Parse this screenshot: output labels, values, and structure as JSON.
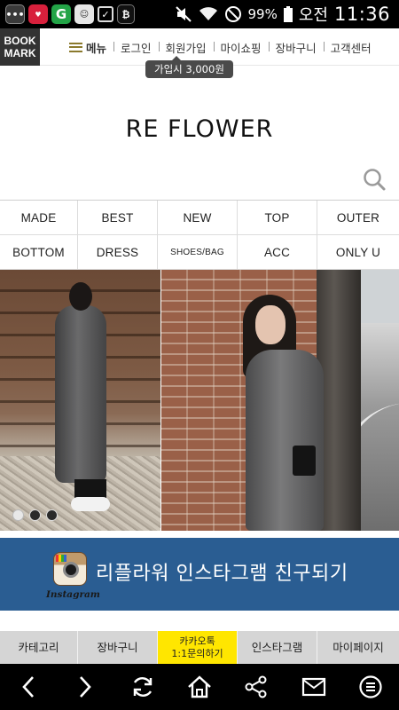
{
  "status_bar": {
    "apps": [
      "message-icon",
      "shopping-icon",
      "g-app-icon",
      "robot-icon",
      "check-icon",
      "bitcoin-icon"
    ],
    "g_app_label": "G",
    "battery": "99%",
    "ampm": "오전",
    "time": "11:36"
  },
  "nav": {
    "bookmark_line1": "BOOK",
    "bookmark_line2": "MARK",
    "menu_label": "메뉴",
    "links": [
      "로그인",
      "회원가입",
      "마이쇼핑",
      "장바구니",
      "고객센터"
    ],
    "tooltip": "가입시 3,000원"
  },
  "logo": "RE FLOWER",
  "categories": [
    "MADE",
    "BEST",
    "NEW",
    "TOP",
    "OUTER",
    "BOTTOM",
    "DRESS",
    "SHOES/BAG",
    "ACC",
    "ONLY U"
  ],
  "banner": {
    "slide_count": 3,
    "active_slide": 1
  },
  "instagram": {
    "wordmark": "Instagram",
    "text": "리플라워 인스타그램 친구되기"
  },
  "quick_bar": {
    "items": [
      "카테고리",
      "장바구니",
      "카카오톡",
      "인스타그램",
      "마이페이지"
    ],
    "kakao_line2": "1:1문의하기"
  },
  "colors": {
    "instagram_banner": "#2a5d92",
    "kakao": "#ffe600",
    "bookmark_bg": "#333333"
  },
  "browser_bar": [
    "back-icon",
    "forward-icon",
    "refresh-icon",
    "home-icon",
    "share-icon",
    "mail-icon",
    "menu-icon"
  ]
}
